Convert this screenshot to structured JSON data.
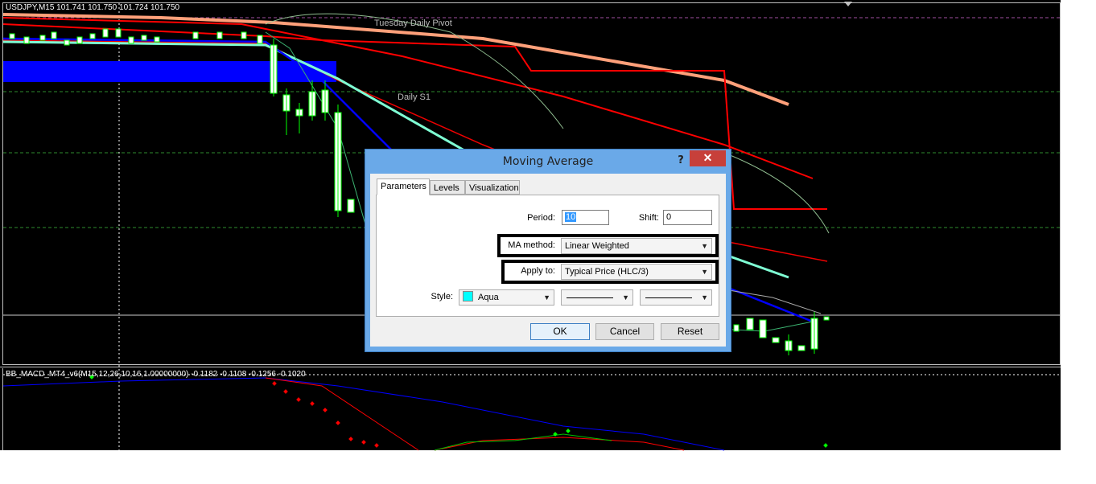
{
  "chart": {
    "symbol_header": "USDJPY,M15  101.741 101.750 101.724 101.750",
    "pivot_label": "Tuesday  Daily Pivot",
    "s1_label": "Daily S1",
    "indicator_header": "BB_MACD_MT4_v6(M15,12,26,10,16,1.00000000) -0.1182 -0.1108 -0.1256 -0.1020"
  },
  "dialog": {
    "title": "Moving Average",
    "help": "?",
    "close": "✕",
    "tabs": [
      {
        "label": "Parameters",
        "active": true
      },
      {
        "label": "Levels",
        "active": false
      },
      {
        "label": "Visualization",
        "active": false
      }
    ],
    "period": {
      "label": "Period:",
      "value": "10"
    },
    "shift": {
      "label": "Shift:",
      "value": "0"
    },
    "ma_method": {
      "label": "MA method:",
      "value": "Linear Weighted"
    },
    "apply_to": {
      "label": "Apply to:",
      "value": "Typical Price (HLC/3)"
    },
    "style": {
      "label": "Style:",
      "color_name": "Aqua",
      "color_hex": "#00ffff"
    },
    "buttons": {
      "ok": "OK",
      "cancel": "Cancel",
      "reset": "Reset"
    }
  }
}
